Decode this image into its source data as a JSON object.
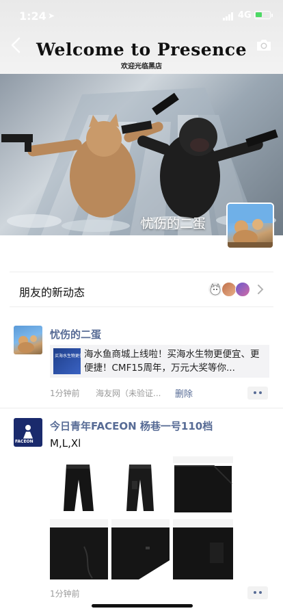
{
  "status_bar": {
    "time": "1:24",
    "network": "4G"
  },
  "cover": {
    "title": "Welcome to Presence",
    "subtitle": "欢迎光临黑店",
    "profile_name": "忧伤的二蛋"
  },
  "activity": {
    "label": "朋友的新动态"
  },
  "posts": [
    {
      "name": "忧伤的二蛋",
      "link_thumb_text": "买海水生物更便宜",
      "link_text": "海水鱼商城上线啦！买海水生物更便宜、更便捷！CMF15周年，万元大奖等你...",
      "time": "1分钟前",
      "source": "海友网（未验证...",
      "delete_label": "删除"
    },
    {
      "name": "今日青年FACEON 杨巷一号110档",
      "text": "M,L,Xl",
      "avatar_text": "FACEON",
      "time": "1分钟前"
    }
  ],
  "colors": {
    "link_blue": "#576b95",
    "meta_gray": "#9b9b9b",
    "battery_green": "#4cd964"
  }
}
